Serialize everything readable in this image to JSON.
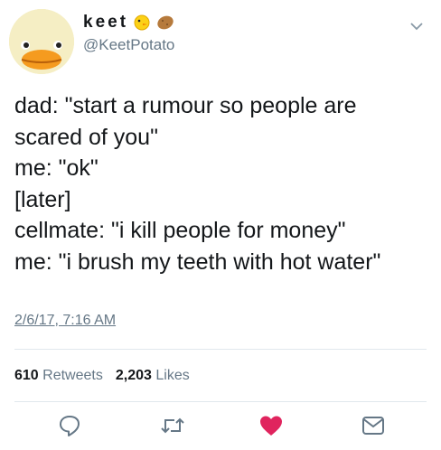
{
  "author": {
    "display_name": "keet",
    "handle": "@KeetPotato",
    "avatar_icon": "duck-icon",
    "name_emojis": [
      "chick-icon",
      "potato-icon"
    ]
  },
  "tweet": {
    "lines": [
      "dad: \"start a rumour so people are",
      "scared of you\"",
      "me: \"ok\"",
      "[later]",
      "cellmate: \"i kill people for money\"",
      "me: \"i brush my teeth with hot water\""
    ],
    "timestamp": "2/6/17, 7:16 AM"
  },
  "stats": {
    "retweets_count": "610",
    "retweets_label": "Retweets",
    "likes_count": "2,203",
    "likes_label": "Likes"
  },
  "actions": [
    "reply-icon",
    "retweet-icon",
    "like-icon",
    "message-icon"
  ],
  "colors": {
    "muted": "#657786",
    "text": "#14171a",
    "like": "#e0245e",
    "divider": "#e1e8ed"
  }
}
